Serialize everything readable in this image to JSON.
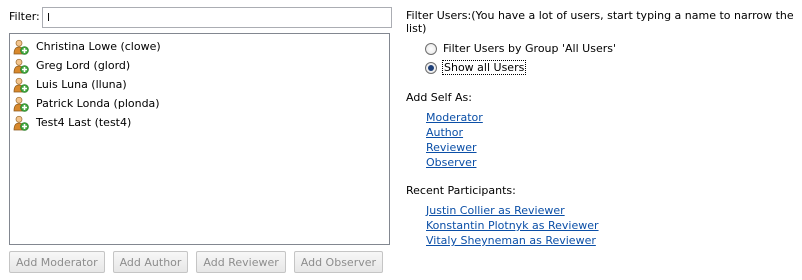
{
  "filter": {
    "label": "Filter:",
    "value": "l"
  },
  "users": [
    {
      "label": "Christina Lowe (clowe)"
    },
    {
      "label": "Greg Lord (glord)"
    },
    {
      "label": "Luis Luna (lluna)"
    },
    {
      "label": "Patrick Londa (plonda)"
    },
    {
      "label": "Test4 Last (test4)"
    }
  ],
  "buttons": {
    "add_moderator": "Add Moderator",
    "add_author": "Add Author",
    "add_reviewer": "Add Reviewer",
    "add_observer": "Add Observer"
  },
  "filter_users": {
    "heading": "Filter Users:(You have a lot of users, start typing a name to narrow the list)",
    "options": [
      {
        "label": "Filter Users by Group 'All Users'",
        "selected": false
      },
      {
        "label": "Show all Users",
        "selected": true
      }
    ]
  },
  "add_self": {
    "heading": "Add Self As:",
    "links": [
      "Moderator",
      "Author",
      "Reviewer",
      "Observer"
    ]
  },
  "recent": {
    "heading": "Recent Participants:",
    "links": [
      "Justin Collier as Reviewer",
      "Konstantin Plotnyk as Reviewer",
      "Vitaly Sheyneman as Reviewer"
    ]
  },
  "colors": {
    "link": "#0b4fa7",
    "disabled_text": "#8d8d8d",
    "radio_dot": "#1d3f78"
  },
  "icons": {
    "user": "user-add-icon"
  }
}
